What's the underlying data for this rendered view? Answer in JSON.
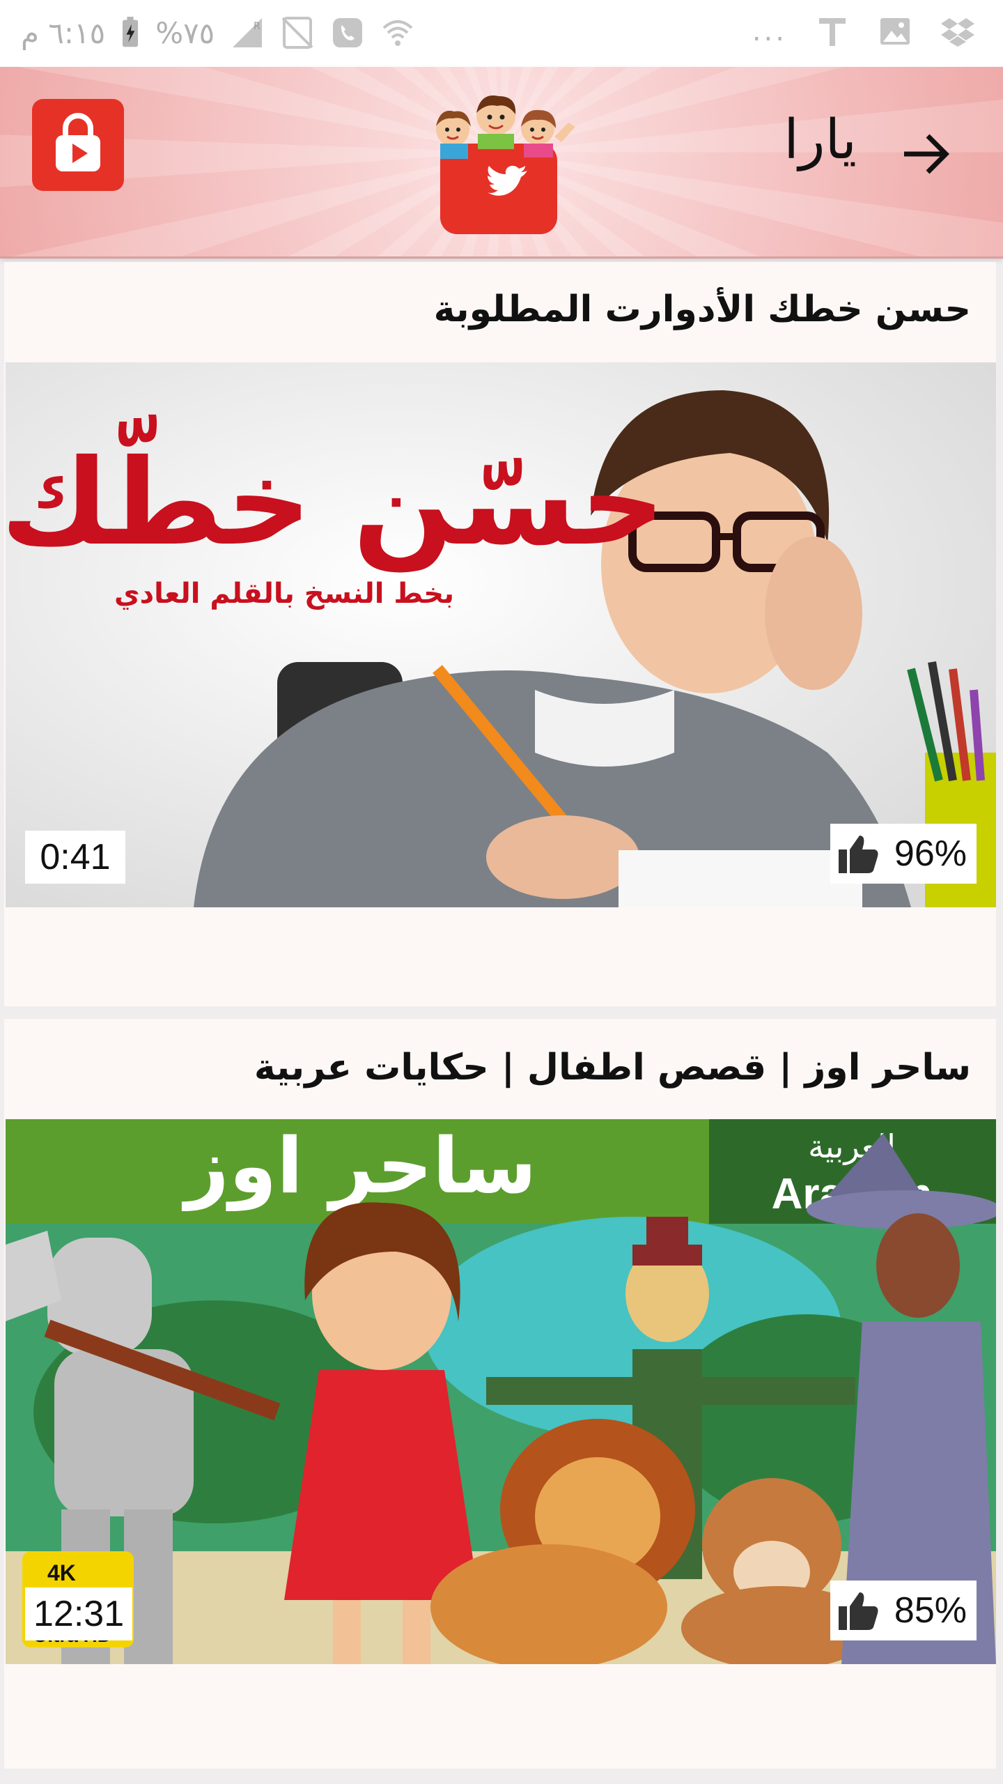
{
  "status_bar": {
    "time": "٦:١٥ م",
    "battery": "%٧٥",
    "overflow": "..."
  },
  "app_bar": {
    "title": "يارا",
    "back_icon": "arrow-right-icon",
    "logo_icon": "kids-twitter-logo",
    "action_icon": "locked-play-icon"
  },
  "videos": [
    {
      "title": "حسن خطك الأدوارت المطلوبة",
      "thumb_heading": "حسّن خطّك",
      "thumb_subheading": "بخط النسخ بالقلم العادي",
      "duration": "0:41",
      "rating": "96%"
    },
    {
      "title": "ساحر اوز | قصص اطفال | حكايات عربية",
      "thumb_heading": "ساحر اوز",
      "thumb_lang_ar": "العربية",
      "thumb_lang_en": "Arabian",
      "thumb_badge_top": "4K",
      "thumb_badge_bottom": "Ultra HD",
      "duration": "12:31",
      "rating": "85%"
    }
  ],
  "colors": {
    "brand_red": "#e63127",
    "appbar_pink": "#f3b8b6",
    "card_bg": "#fdf8f6"
  }
}
